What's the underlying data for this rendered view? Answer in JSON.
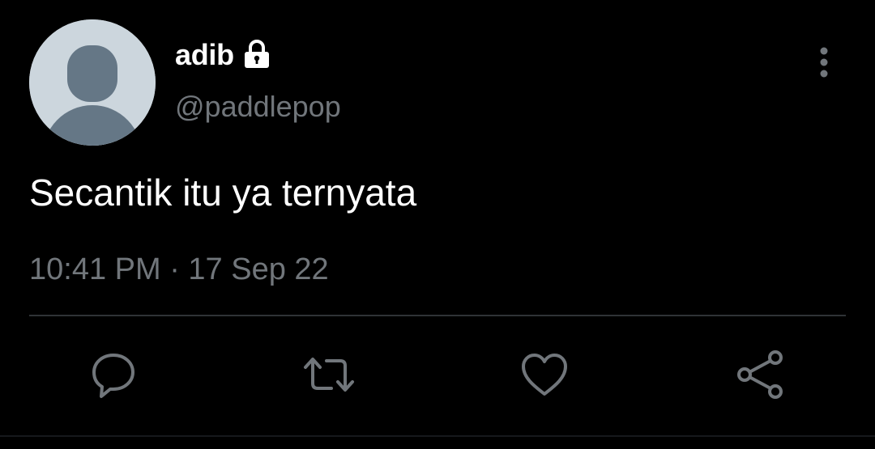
{
  "user": {
    "display_name": "adib",
    "handle": "@paddlepop",
    "protected": true,
    "avatar": "default-profile-icon"
  },
  "tweet": {
    "text": "Secantik itu ya ternyata",
    "timestamp": "10:41 PM · 17 Sep 22"
  },
  "actions": [
    {
      "name": "reply",
      "icon": "speech-bubble-icon"
    },
    {
      "name": "retweet",
      "icon": "retweet-arrows-icon"
    },
    {
      "name": "like",
      "icon": "heart-icon"
    },
    {
      "name": "share",
      "icon": "share-nodes-icon"
    }
  ],
  "icons": {
    "more": "vertical-dots-icon",
    "lock": "lock-icon"
  },
  "colors": {
    "background": "#000000",
    "primary_text": "#ffffff",
    "secondary_text": "#71767b",
    "divider": "#2f3336",
    "avatar_bg": "#ccd6dd",
    "avatar_figure": "#657786"
  }
}
